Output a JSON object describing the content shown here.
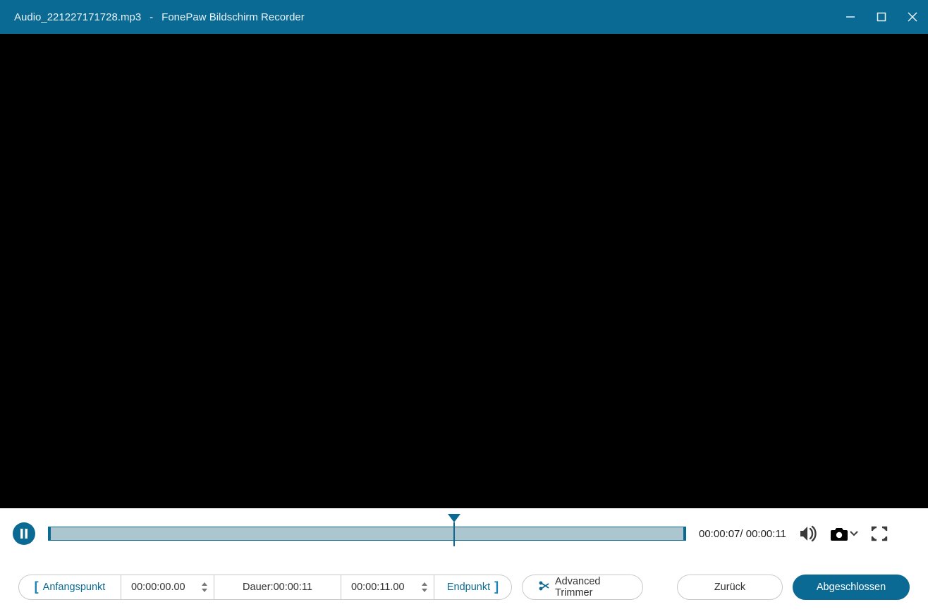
{
  "title": {
    "filename": "Audio_221227171728.mp3",
    "separator": "-",
    "app_name": "FonePaw Bildschirm Recorder"
  },
  "playback": {
    "current_time": "00:00:07",
    "total_time": "00:00:11",
    "time_display": "00:00:07/ 00:00:11",
    "progress_percent": 63.6
  },
  "trim": {
    "start_label": "Anfangspunkt",
    "start_time": "00:00:00.00",
    "duration_label": "Dauer:",
    "duration_value": "00:00:11",
    "end_time": "00:00:11.00",
    "end_label": "Endpunkt"
  },
  "buttons": {
    "advanced_trimmer": "Advanced Trimmer",
    "back": "Zurück",
    "done": "Abgeschlossen"
  }
}
